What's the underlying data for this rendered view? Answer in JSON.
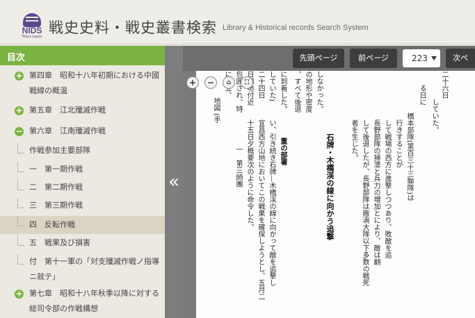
{
  "header": {
    "logo": {
      "nids": "NIDS",
      "tokyo": "Tokyo Japan"
    },
    "title": "戦史史料・戦史叢書検索",
    "subtitle": "Library & Historical records Search System"
  },
  "sidebar": {
    "toc_label": "目次",
    "collapse_glyph": "«",
    "items": [
      {
        "text": "第四章　昭和十八年初期における中國戦線の概温"
      },
      {
        "text": "第五章　江北殲滅作戦"
      },
      {
        "text": "第六章　江南殲滅作戦"
      },
      {
        "text": "作戦参加主要部隊"
      },
      {
        "text": "一　第一期作戦"
      },
      {
        "text": "二　第二期作戦"
      },
      {
        "text": "三　第三期作戦"
      },
      {
        "text": "四　反転作戦"
      },
      {
        "text": "五　戦果及び損害"
      },
      {
        "text": "付　第十一軍の「対支殲滅作戦ノ指導ニ就テ」"
      },
      {
        "text": "第七章　昭和十八年秋季以降に対する総司令部の作戦構想"
      }
    ]
  },
  "toolbar": {
    "first_page": "先頭ページ",
    "prev_page": "前ページ",
    "page_number": "223",
    "next_page": "次ペ"
  },
  "document": {
    "columns": [
      "に到着した。",
      "していた)",
      "二十四日",
      "日同地付近",
      "包囲され、特",
      "に孤立、",
      "地図 (手",
      "、すべて後退",
      "の地形や密度",
      "しなかった。",
      "い、引き続き石牌—木橋渓の線に向かって敵を追撃し",
      "宜昌西方山地においてこの戦果を確保しようとし、五月二",
      "十五日夕概要次のように命令した。",
      "一　第三師團",
      "重の部署　",
      "石牌・木橋渓の線に向かう追撃",
      "者を生じた。",
      "して後退したが、長野部隊は廠渦大隊以下多数の戦死",
      "長野部隊の掃蕩と兵力の増加とにより、敵は翻",
      "して戦場の西方に進撃しつつあり、敗敵を追",
      "行きすることが",
      "橋本部隊(第百三十三聯隊)は",
      "る日に",
      "していた。",
      "二十六日"
    ]
  }
}
